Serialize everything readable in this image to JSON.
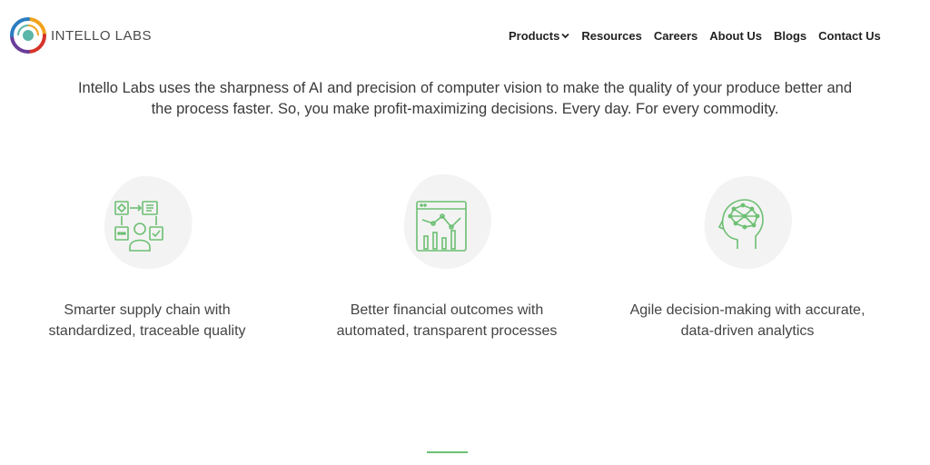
{
  "brand": {
    "name": "INTELLO LABS"
  },
  "nav": {
    "items": [
      "Products",
      "Resources",
      "Careers",
      "About Us",
      "Blogs",
      "Contact Us"
    ]
  },
  "intro": {
    "line1": "Intello Labs uses the sharpness of AI and precision of computer vision to make the quality of your produce better and",
    "line2": "the process faster. So, you make profit-maximizing decisions. Every day. For every commodity."
  },
  "features": [
    {
      "icon": "supply-chain-icon",
      "line1": "Smarter supply chain with",
      "line2": "standardized, traceable quality"
    },
    {
      "icon": "analytics-dashboard-icon",
      "line1": "Better financial outcomes with",
      "line2": "automated, transparent processes"
    },
    {
      "icon": "brain-head-icon",
      "line1": "Agile decision-making with accurate,",
      "line2": "data-driven analytics"
    }
  ],
  "colors": {
    "accent": "#6cbf72",
    "blob": "#f3f3f3",
    "text": "#3a3a3a"
  }
}
